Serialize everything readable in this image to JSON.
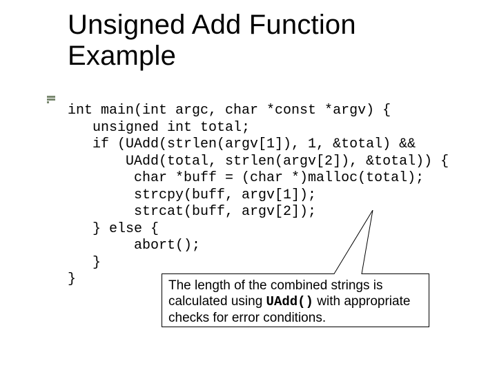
{
  "title": "Unsigned Add Function\nExample",
  "code_lines": [
    "int main(int argc, char *const *argv) {",
    "   unsigned int total;",
    "   if (UAdd(strlen(argv[1]), 1, &total) &&",
    "       UAdd(total, strlen(argv[2]), &total)) {",
    "        char *buff = (char *)malloc(total);",
    "        strcpy(buff, argv[1]);",
    "        strcat(buff, argv[2]);",
    "   } else {",
    "        abort();",
    "   }",
    "}"
  ],
  "callout": {
    "prefix": "The length of the combined strings is calculated using ",
    "mono": "UAdd()",
    "suffix": " with appropriate checks for error conditions."
  }
}
